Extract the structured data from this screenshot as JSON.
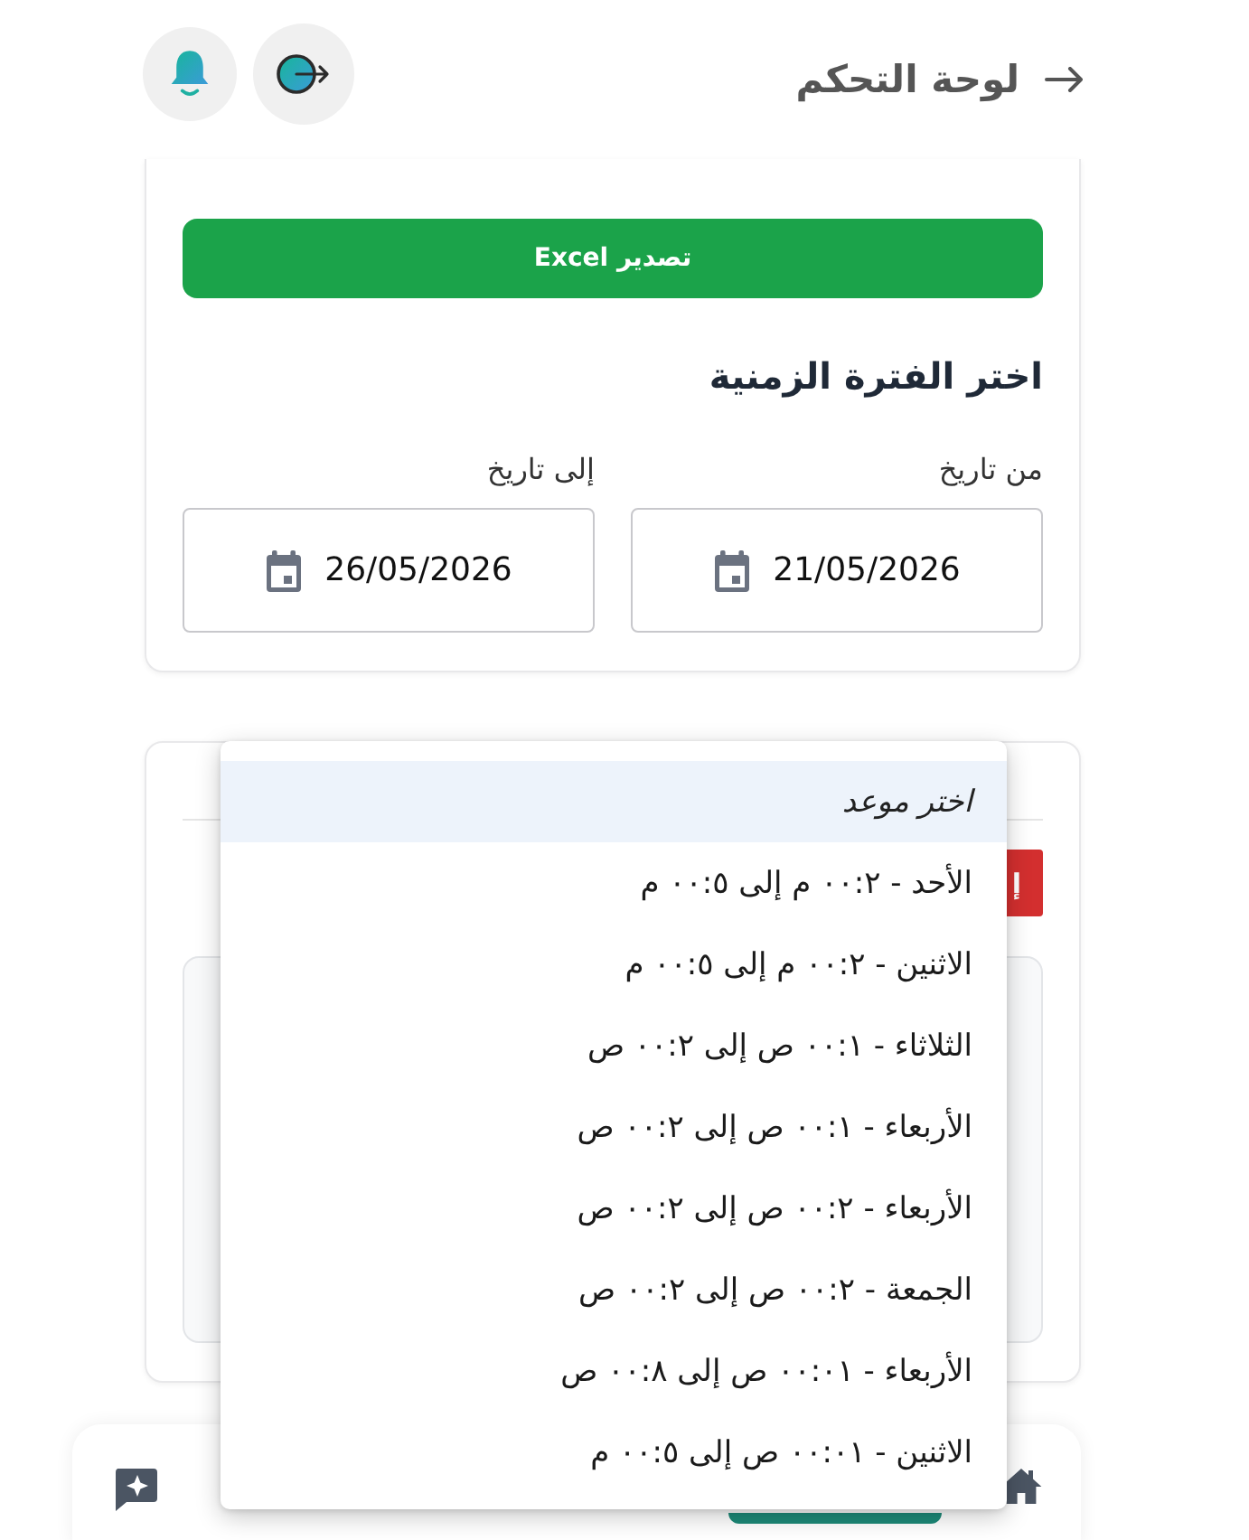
{
  "header": {
    "title": "لوحة التحكم"
  },
  "export_button": {
    "label": "تصدير Excel"
  },
  "date_range": {
    "heading": "اختر الفترة الزمنية",
    "fields": [
      {
        "label": "من تاريخ",
        "value": "21/05/2026"
      },
      {
        "label": "إلى تاريخ",
        "value": "26/05/2026"
      }
    ]
  },
  "panel": {
    "button": {
      "label": "إ"
    }
  },
  "dropdown": {
    "options": [
      {
        "label": "اختر موعد",
        "kind": "placeholder",
        "selected": true
      },
      {
        "label": "الأحد - ٢:٠٠ م إلى ٥:٠٠ م",
        "kind": "option",
        "selected": false
      },
      {
        "label": "الاثنين - ٢:٠٠ م إلى ٥:٠٠ م",
        "kind": "option",
        "selected": false
      },
      {
        "label": "الثلاثاء - ١:٠٠ ص إلى ٢:٠٠ ص",
        "kind": "option",
        "selected": false
      },
      {
        "label": "الأربعاء - ١:٠٠ ص إلى ٢:٠٠ ص",
        "kind": "option",
        "selected": false
      },
      {
        "label": "الأربعاء - ٢:٠٠ ص إلى ٢:٠٠ ص",
        "kind": "option",
        "selected": false
      },
      {
        "label": "الجمعة - ٢:٠٠ ص إلى ٢:٠٠ ص",
        "kind": "option",
        "selected": false
      },
      {
        "label": "الأربعاء - ١٠:٠٠ ص إلى ٨:٠٠ ص",
        "kind": "option",
        "selected": false
      },
      {
        "label": "الاثنين - ١٠:٠٠ ص إلى ٥:٠٠ م",
        "kind": "option",
        "selected": false
      }
    ]
  }
}
